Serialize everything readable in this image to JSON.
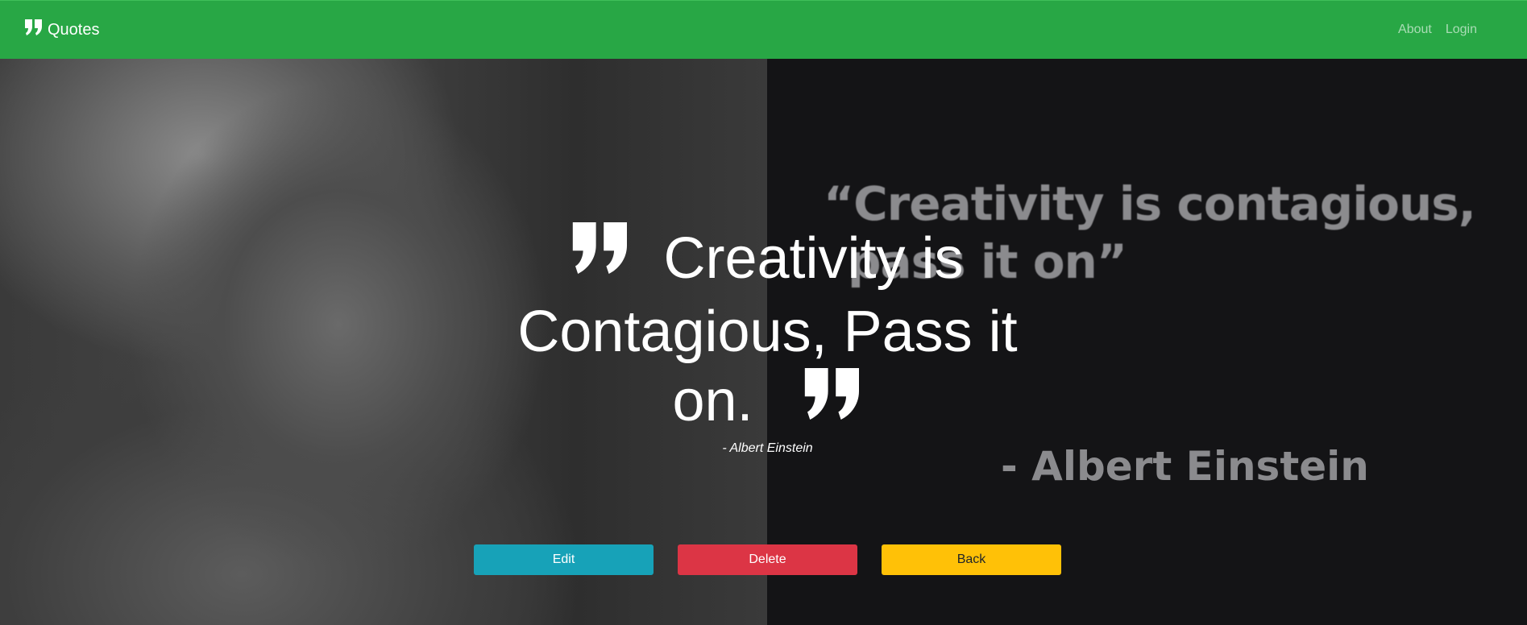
{
  "navbar": {
    "brand_icon": "quote-right-icon",
    "brand_label": "Quotes",
    "background": "#28a745",
    "links": [
      {
        "label": "About"
      },
      {
        "label": "Login"
      }
    ]
  },
  "background_image": {
    "quote_line1": "“Creativity is contagious,",
    "quote_line2": "pass it on”",
    "author": "- Albert Einstein"
  },
  "quote": {
    "open_icon": "quote-open-icon",
    "text": "Creativity is Contagious, Pass it on.",
    "close_icon": "quote-close-icon",
    "author": "- Albert Einstein"
  },
  "actions": {
    "edit_label": "Edit",
    "delete_label": "Delete",
    "back_label": "Back",
    "edit_color": "#17a2b8",
    "delete_color": "#dc3545",
    "back_color": "#ffc107"
  }
}
